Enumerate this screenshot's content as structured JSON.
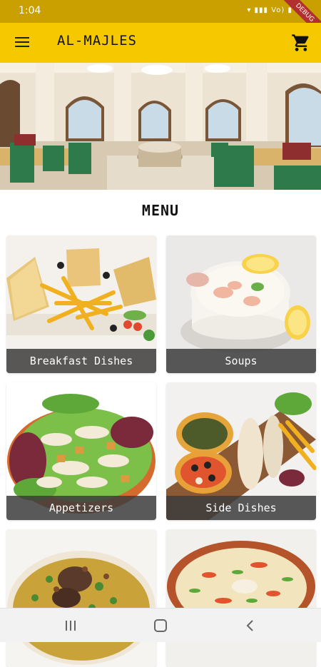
{
  "status_bar": {
    "time": "1:04",
    "icons_text": "▾ ▮▮▮ Vo) ▮",
    "debug_badge": "DEBUG"
  },
  "app_bar": {
    "title": "AL-MAJLES",
    "menu_icon": "hamburger-menu-icon",
    "cart_icon": "shopping-cart-icon",
    "color": "#f6c800"
  },
  "menu": {
    "title": "MENU",
    "categories": [
      {
        "label": "Breakfast Dishes"
      },
      {
        "label": "Soups"
      },
      {
        "label": "Appetizers"
      },
      {
        "label": "Side Dishes"
      },
      {
        "label": ""
      },
      {
        "label": ""
      }
    ]
  },
  "nav_bar": {
    "recents_icon": "recents-icon",
    "home_icon": "home-icon",
    "back_icon": "back-icon"
  }
}
